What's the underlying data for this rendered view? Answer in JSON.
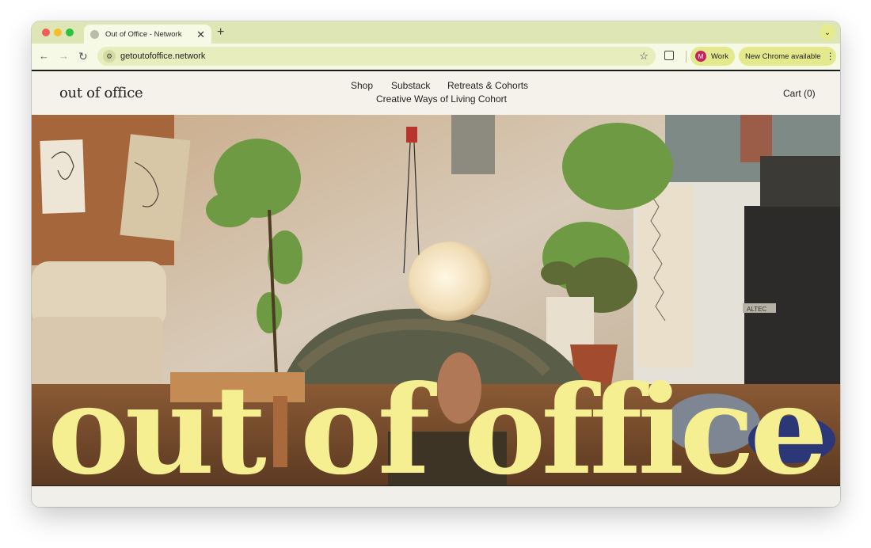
{
  "browser": {
    "tab": {
      "title": "Out of Office - Network"
    },
    "toolbar": {
      "url": "getoutofoffice.network",
      "profile": {
        "initial": "M",
        "name": "Work"
      },
      "update_label": "New Chrome available"
    },
    "icons": [
      "back-arrow-icon",
      "forward-arrow-icon",
      "reload-icon",
      "site-info-icon",
      "star-icon",
      "extensions-icon",
      "kebab-menu-icon",
      "close-icon",
      "plus-icon",
      "chevron-down-icon"
    ]
  },
  "site": {
    "logo": "out of office",
    "nav": {
      "shop": "Shop",
      "substack": "Substack",
      "retreats": "Retreats & Cohorts",
      "creative": "Creative Ways of Living Cohort"
    },
    "cart": "Cart (0)",
    "hero": {
      "wordmark": "out of office",
      "speaker_badge": "ALTEC",
      "wordmark_color": "#f6ef92"
    }
  }
}
